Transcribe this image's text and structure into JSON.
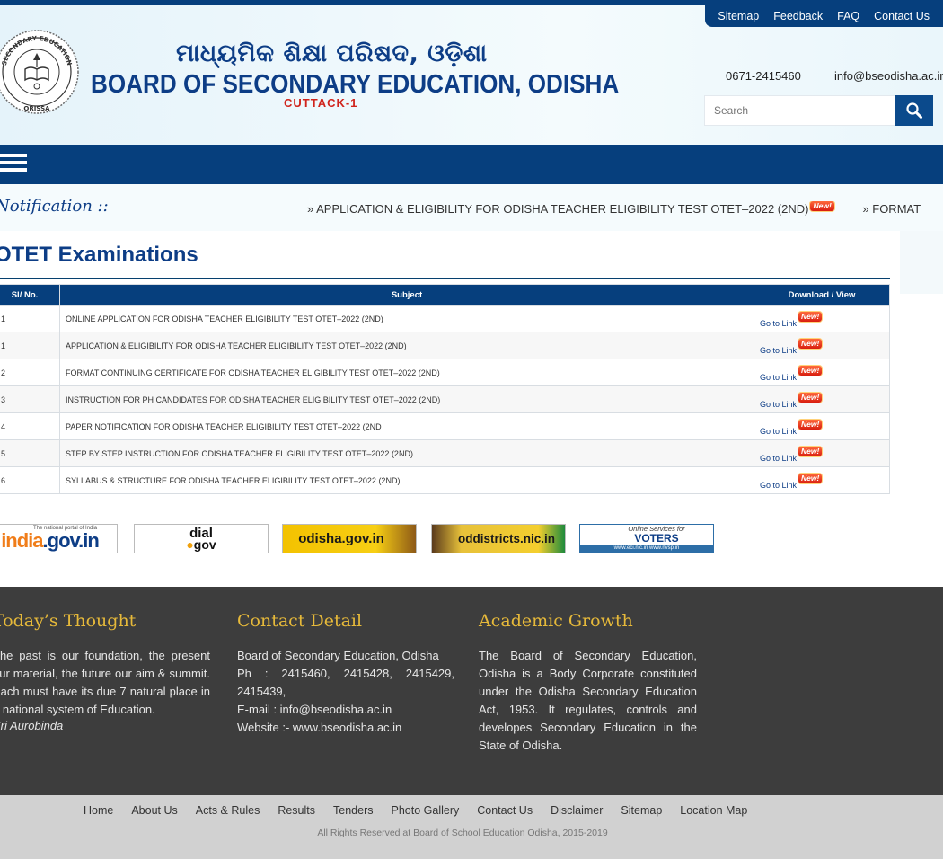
{
  "top_links": [
    "Sitemap",
    "Feedback",
    "FAQ",
    "Contact Us"
  ],
  "header": {
    "title_odia": "ମାଧ୍ୟମିକ ଶିକ୍ଷା ପରିଷଦ, ଓଡ଼ିଶା",
    "title": "BOARD OF SECONDARY EDUCATION, ODISHA",
    "subtitle": "CUTTACK-1",
    "emblem_text_top": "SECONDARY EDUCATION",
    "emblem_text_bottom": "ORISSA",
    "phone": "0671-2415460",
    "email": "info@bseodisha.ac.in",
    "search_placeholder": "Search"
  },
  "notification": {
    "label": "Notification ::",
    "ticker_items": [
      "» APPLICATION & ELIGIBILITY FOR ODISHA TEACHER ELIGIBILITY TEST OTET–2022 (2ND)",
      "» FORMAT CONTINUING CERTIFICATE FOR ODISHA TEACHER ELIGIBILITY TEST OTET–2022 (2ND)"
    ],
    "new_badge": "New!"
  },
  "main": {
    "title": "OTET Examinations",
    "columns": [
      "Sl/ No.",
      "Subject",
      "Download / View"
    ],
    "rows": [
      {
        "sl": "1",
        "subject": "ONLINE APPLICATION FOR ODISHA TEACHER ELIGIBILITY TEST OTET–2022 (2ND)",
        "link": "Go to Link"
      },
      {
        "sl": "1",
        "subject": "APPLICATION & ELIGIBILITY FOR ODISHA TEACHER ELIGIBILITY TEST OTET–2022 (2ND)",
        "link": "Go to Link"
      },
      {
        "sl": "2",
        "subject": "FORMAT CONTINUING CERTIFICATE FOR ODISHA TEACHER ELIGIBILITY TEST OTET–2022 (2ND)",
        "link": "Go to Link"
      },
      {
        "sl": "3",
        "subject": "INSTRUCTION FOR PH CANDIDATES FOR ODISHA TEACHER ELIGIBILITY TEST OTET–2022 (2ND)",
        "link": "Go to Link"
      },
      {
        "sl": "4",
        "subject": "PAPER NOTIFICATION FOR ODISHA TEACHER ELIGIBILITY TEST OTET–2022 (2ND",
        "link": "Go to Link"
      },
      {
        "sl": "5",
        "subject": "STEP BY STEP INSTRUCTION FOR ODISHA TEACHER ELIGIBILITY TEST OTET–2022 (2ND)",
        "link": "Go to Link"
      },
      {
        "sl": "6",
        "subject": "SYLLABUS & STRUCTURE FOR ODISHA TEACHER ELIGIBILITY TEST OTET–2022 (2ND)",
        "link": "Go to Link"
      }
    ]
  },
  "banners": {
    "india_tagline": "The national portal of India",
    "india_prefix": "india",
    "india_suffix": ".gov.in",
    "dial_top": "dial",
    "dial_bottom": "gov",
    "odisha": "odisha.gov.in",
    "oddistricts": "oddistricts.nic.in",
    "voters_top": "Online Services for",
    "voters_main": "VOTERS",
    "voters_url": "www.eci.nic.in  www.nvsp.in"
  },
  "footer": {
    "thought": {
      "heading": "Today’s Thought",
      "body": "The past is our foundation, the present our material, the future our aim & summit. Each must have its due 7 natural place in a national system of Education.",
      "author": "Sri Aurobinda"
    },
    "contact": {
      "heading": "Contact Detail",
      "lines": [
        "Board of Secondary Education, Odisha",
        "Ph : 2415460, 2415428, 2415429, 2415439,",
        "E-mail : info@bseodisha.ac.in",
        "Website :- www.bseodisha.ac.in"
      ]
    },
    "academic": {
      "heading": "Academic Growth",
      "body": "The Board of Secondary Education, Odisha is a Body Corporate constituted under the Odisha Secondary Education Act, 1953. It regulates, controls and developes Secondary Education in the State of Odisha."
    }
  },
  "bottom_nav": [
    "Home",
    "About Us",
    "Acts & Rules",
    "Results",
    "Tenders",
    "Photo Gallery",
    "Contact Us",
    "Disclaimer",
    "Sitemap",
    "Location Map"
  ],
  "copyright": "All Rights Reserved at Board of School Education Odisha, 2015-2019",
  "colors": {
    "navy": "#063f7d",
    "gold": "#e6b93a",
    "footer_bg": "#3d3d3d",
    "badge_red": "#d81c0f"
  }
}
